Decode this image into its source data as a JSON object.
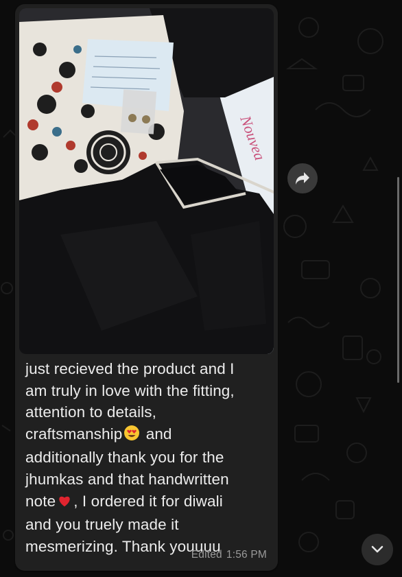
{
  "message": {
    "lines": [
      "just recieved the product and I",
      "am truly in love with the fitting,",
      "attention to details,",
      "craftsmanship",
      " and",
      "additionally thank you for the",
      "jhumkas and that handwritten",
      "note",
      ", I ordered it for diwali",
      "and you truely made it",
      "mesmerizing. Thank youuuu"
    ],
    "emoji_1": "heart-eyes-emoji",
    "emoji_2": "red-heart-emoji",
    "edited_label": "Edited",
    "time": "1:56 PM"
  },
  "photo": {
    "package_brand_text": "Nouvea"
  },
  "icons": {
    "forward": "forward-arrow-icon",
    "scroll_down": "chevron-down-icon"
  },
  "colors": {
    "background": "#0c0c0c",
    "bubble": "#202020",
    "text": "#ececec",
    "meta": "#9a9a9a",
    "emoji_heart": "#e0242f",
    "emoji_face": "#f7c531"
  }
}
